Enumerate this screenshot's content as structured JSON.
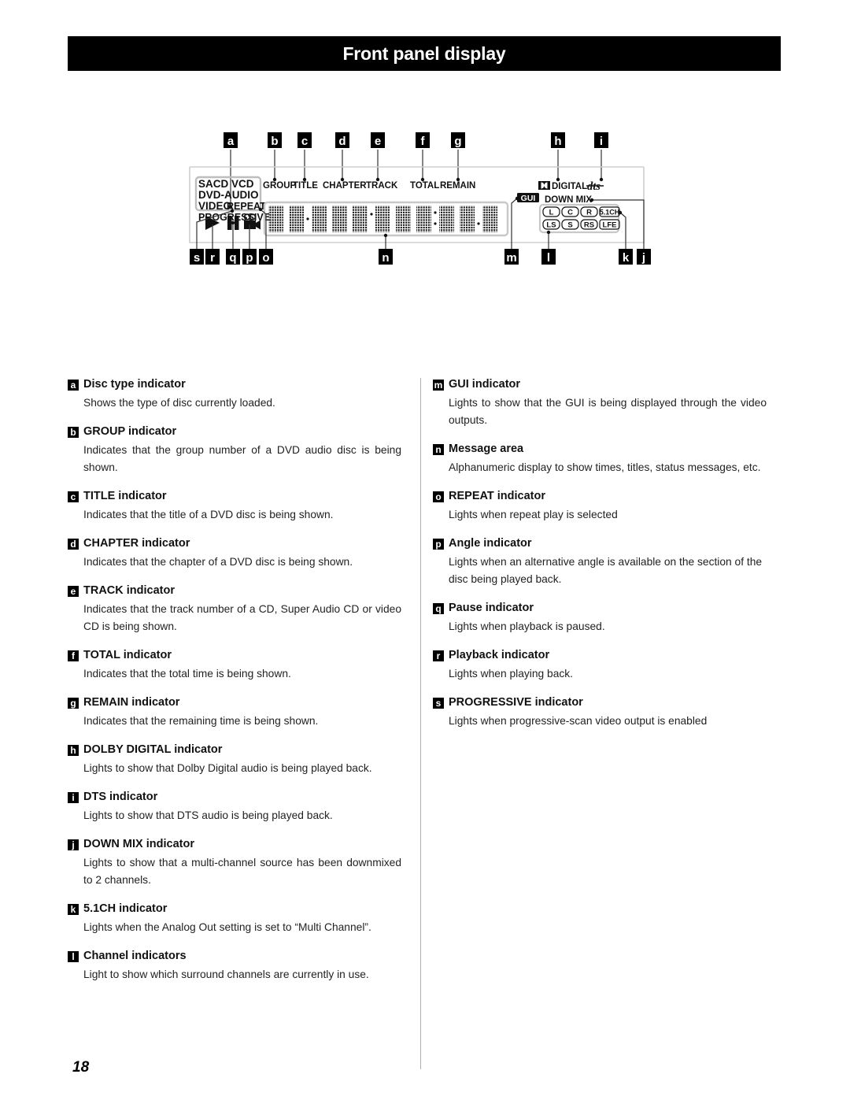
{
  "header": {
    "title": "Front panel display"
  },
  "diagram": {
    "top_markers": [
      "a",
      "b",
      "c",
      "d",
      "e",
      "f",
      "g",
      "h",
      "i"
    ],
    "bottom_markers": [
      "s",
      "r",
      "q",
      "p",
      "o",
      "n",
      "m",
      "l",
      "k",
      "j"
    ],
    "disc_types": [
      "SACD",
      "VCD",
      "DVD-AUDIO",
      "VIDEO"
    ],
    "repeat_label": "REPEAT",
    "progressive_label": "PROGRESSIVE",
    "mode_labels": [
      "GROUP",
      "TITLE",
      "CHAPTER",
      "TRACK",
      "TOTAL",
      "REMAIN"
    ],
    "dolby_label": "DIGITAL",
    "dts_label": "dts",
    "gui_badge": "GUI",
    "downmix_label": "DOWN MIX",
    "channel_row_1": [
      "L",
      "C",
      "R",
      "5.1CH"
    ],
    "channel_row_2": [
      "LS",
      "S",
      "RS",
      "LFE"
    ],
    "transport_icons": [
      "play-icon",
      "pause-icon",
      "angle-camera-icon"
    ],
    "message_area_cells": 10
  },
  "left_column": [
    {
      "marker": "a",
      "title": "Disc type indicator",
      "body": "Shows the type of disc currently loaded."
    },
    {
      "marker": "b",
      "title": "GROUP indicator",
      "body": "Indicates that the group number of a DVD audio disc is being shown."
    },
    {
      "marker": "c",
      "title": "TITLE indicator",
      "body": "Indicates that the title of a DVD disc is being shown."
    },
    {
      "marker": "d",
      "title": "CHAPTER indicator",
      "body": "Indicates that the chapter of a DVD disc is being shown."
    },
    {
      "marker": "e",
      "title": "TRACK indicator",
      "body": "Indicates that the track number of a CD, Super Audio CD or video CD is being shown."
    },
    {
      "marker": "f",
      "title": "TOTAL indicator",
      "body": "Indicates that the total time is being shown."
    },
    {
      "marker": "g",
      "title": "REMAIN indicator",
      "body": "Indicates that the remaining time is being shown."
    },
    {
      "marker": "h",
      "title": "DOLBY DIGITAL indicator",
      "body": "Lights to show that Dolby Digital audio is being played back."
    },
    {
      "marker": "i",
      "title": "DTS indicator",
      "body": "Lights to show that DTS audio is being played back."
    },
    {
      "marker": "j",
      "title": "DOWN MIX indicator",
      "body": "Lights to show that a multi-channel source has been downmixed to 2 channels."
    },
    {
      "marker": "k",
      "title": "5.1CH indicator",
      "body": "Lights when the Analog Out setting is set to “Multi Channel”."
    },
    {
      "marker": "l",
      "title": "Channel indicators",
      "body": "Light to show which surround channels are currently in use."
    }
  ],
  "right_column": [
    {
      "marker": "m",
      "title": "GUI indicator",
      "body": "Lights to show that the GUI is being displayed through the video outputs."
    },
    {
      "marker": "n",
      "title": "Message area",
      "body": "Alphanumeric display to show times, titles, status messages, etc."
    },
    {
      "marker": "o",
      "title": "REPEAT indicator",
      "body": "Lights when repeat play is selected"
    },
    {
      "marker": "p",
      "title": "Angle indicator",
      "body": "Lights when an alternative angle is available on the section of the disc being played back."
    },
    {
      "marker": "q",
      "title": "Pause indicator",
      "body": "Lights when playback is paused."
    },
    {
      "marker": "r",
      "title": "Playback indicator",
      "body": "Lights when playing back."
    },
    {
      "marker": "s",
      "title": "PROGRESSIVE indicator",
      "body": "Lights when progressive-scan video output is enabled"
    }
  ],
  "footer": {
    "page_number": "18"
  }
}
